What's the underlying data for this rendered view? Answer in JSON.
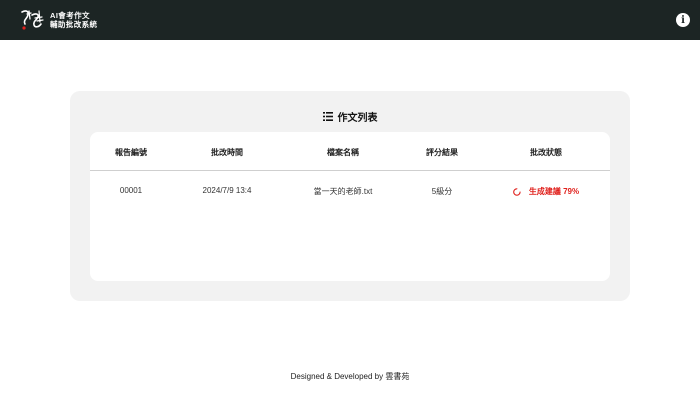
{
  "header": {
    "brand_line1": "AI會考作文",
    "brand_line2": "輔助批改系統",
    "logo_icon": "calligraphy-logo",
    "info_icon": "info-icon",
    "colors": {
      "bar": "#1c2524"
    }
  },
  "panel": {
    "title": "作文列表",
    "title_icon": "list-icon"
  },
  "table": {
    "headers": [
      "報告編號",
      "批改時間",
      "檔案名稱",
      "評分結果",
      "批改狀態"
    ],
    "rows": [
      {
        "id": "00001",
        "time": "2024/7/9 13:4",
        "filename": "當一天的老師.txt",
        "score": "5級分",
        "status": "生成建議 79%",
        "status_icon": "spinner-icon",
        "progress": 0.79
      }
    ]
  },
  "footer": {
    "text": "Designed & Developed by 雲書苑"
  },
  "colors": {
    "status_red": "#e0201c",
    "panel_bg": "#f2f2f2"
  }
}
